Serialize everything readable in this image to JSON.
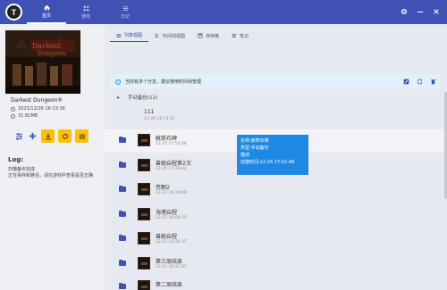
{
  "app": {
    "logo_letter": "T"
  },
  "nav": [
    {
      "label": "首页",
      "icon": "home-icon",
      "active": true
    },
    {
      "label": "游戏",
      "icon": "grid-icon",
      "active": false
    },
    {
      "label": "日记",
      "icon": "menu-icon",
      "active": false
    }
  ],
  "top_right_icons": [
    "gear-icon",
    "minimize-icon",
    "close-icon"
  ],
  "game": {
    "name": "Darkest Dungeon®",
    "date": "2023/12/26 16:13:36",
    "size": "31.81MB"
  },
  "log": {
    "title": "Log:",
    "lines": [
      "扫描备份完成",
      "正在保存新路径，请在游戏中查看是否正确"
    ]
  },
  "tabs": [
    {
      "label": "列表视图",
      "icon": "list-icon",
      "active": true
    },
    {
      "label": "时间线视图",
      "icon": "timeline-icon",
      "active": false
    },
    {
      "label": "存档格",
      "icon": "save-icon",
      "active": false
    },
    {
      "label": "笔记",
      "icon": "note-icon",
      "active": false
    }
  ],
  "banner": {
    "text": "当前有多个分支，建议使用时间线管理"
  },
  "group": {
    "label": "手动备份(12)"
  },
  "items": [
    {
      "title": "111",
      "time": "12-26 16:13:37",
      "has_thumb": false,
      "has_folder": false
    },
    {
      "title": "献祭石碑",
      "time": "12-25 17:52:48",
      "has_thumb": true,
      "has_folder": true,
      "selected": true
    },
    {
      "title": "兽娘启程第2次",
      "time": "12-25 17:39:42",
      "has_thumb": true,
      "has_folder": true
    },
    {
      "title": "荒野2",
      "time": "12-12 16:39:49",
      "has_thumb": true,
      "has_folder": true
    },
    {
      "title": "海港启程",
      "time": "12-12 16:06:55",
      "has_thumb": true,
      "has_folder": true
    },
    {
      "title": "兽娘启程",
      "time": "12-12 15:34:37",
      "has_thumb": true,
      "has_folder": true
    },
    {
      "title": "第三周结束",
      "time": "12-11 20:37:37",
      "has_thumb": true,
      "has_folder": true
    },
    {
      "title": "第二周结束",
      "time": "",
      "has_thumb": true,
      "has_folder": true
    }
  ],
  "tooltip": {
    "lines": [
      "名称:献祭石碑",
      "类型:手动备份",
      "描述:",
      "创建时间:12-25 17:52:48"
    ]
  },
  "colors": {
    "primary": "#3f51b5",
    "accent": "#ffc107",
    "tooltip": "#1e88e5"
  }
}
